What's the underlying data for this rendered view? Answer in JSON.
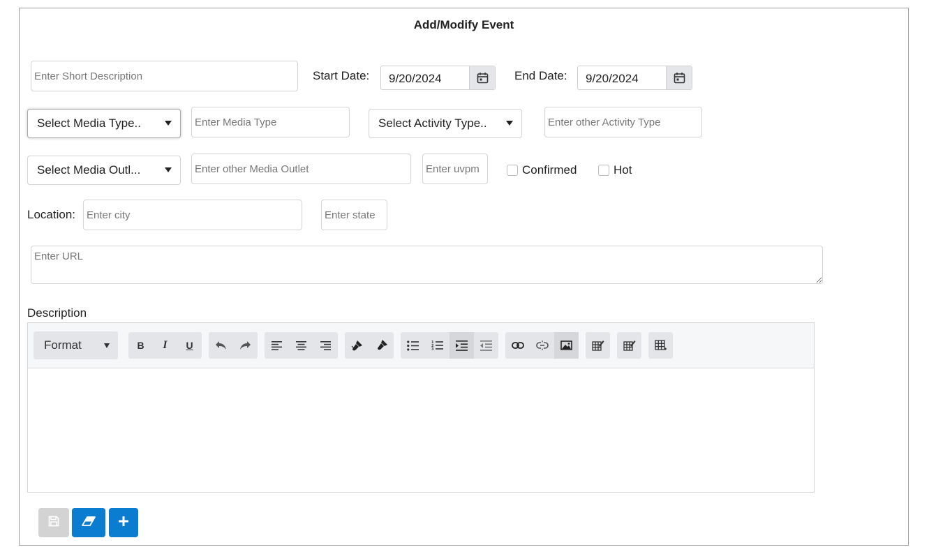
{
  "form": {
    "title": "Add/Modify Event",
    "short_description": {
      "placeholder": "Enter Short Description",
      "value": ""
    },
    "start_date": {
      "label": "Start Date:",
      "value": "9/20/2024"
    },
    "end_date": {
      "label": "End Date:",
      "value": "9/20/2024"
    },
    "media_type_select": {
      "value": "Select Media Type.."
    },
    "media_type_input": {
      "placeholder": "Enter Media Type"
    },
    "activity_type_select": {
      "value": "Select Activity Type.."
    },
    "activity_type_input": {
      "placeholder": "Enter other Activity Type"
    },
    "media_outlet_select": {
      "value": "Select Media Outl..."
    },
    "media_outlet_input": {
      "placeholder": "Enter other Media Outlet"
    },
    "uvpm_input": {
      "placeholder": "Enter uvpm"
    },
    "confirmed": {
      "label": "Confirmed",
      "checked": false
    },
    "hot": {
      "label": "Hot",
      "checked": false
    },
    "location": {
      "label": "Location:"
    },
    "city_input": {
      "placeholder": "Enter city"
    },
    "state_input": {
      "placeholder": "Enter state"
    },
    "url_input": {
      "placeholder": "Enter URL"
    },
    "description": {
      "label": "Description"
    }
  },
  "editor": {
    "format_label": "Format",
    "tools": [
      "bold",
      "italic",
      "underline",
      "undo",
      "redo",
      "align-left",
      "align-center",
      "align-right",
      "paint",
      "clear-format",
      "bullet-list",
      "numbered-list",
      "indent",
      "outdent",
      "link",
      "unlink",
      "image",
      "edit-table",
      "edit-cell",
      "table"
    ]
  },
  "actions": {
    "save": {
      "icon": "save-icon",
      "enabled": false,
      "color": "#d3d3d3"
    },
    "clear": {
      "icon": "eraser-icon",
      "enabled": true,
      "color": "#0a7dd1"
    },
    "add": {
      "icon": "plus-icon",
      "enabled": true,
      "color": "#0a7dd1"
    }
  },
  "colors": {
    "border": "#d4d4d4",
    "primary": "#0a7dd1",
    "toolbar": "#f6f7f9"
  }
}
